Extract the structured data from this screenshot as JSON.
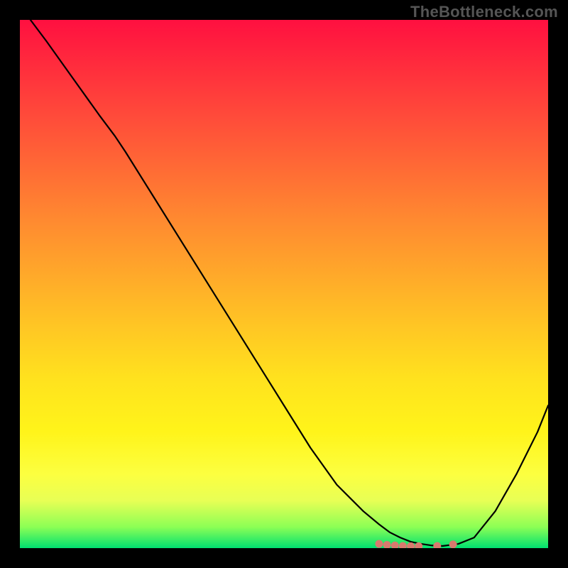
{
  "watermark": "TheBottleneck.com",
  "chart_data": {
    "type": "line",
    "title": "",
    "xlabel": "",
    "ylabel": "",
    "xlim": [
      0,
      100
    ],
    "ylim": [
      0,
      100
    ],
    "grid": false,
    "legend": false,
    "series": [
      {
        "name": "curve",
        "color": "#000000",
        "x": [
          2,
          5,
          10,
          15,
          18,
          20,
          25,
          30,
          35,
          40,
          45,
          50,
          55,
          60,
          63,
          65,
          68,
          70,
          72,
          74,
          76,
          78,
          80,
          83,
          86,
          90,
          94,
          98,
          100
        ],
        "y": [
          100,
          96,
          89,
          82,
          78,
          75,
          67,
          59,
          51,
          43,
          35,
          27,
          19,
          12,
          9,
          7,
          4.5,
          3,
          2,
          1.2,
          0.8,
          0.5,
          0.4,
          0.8,
          2,
          7,
          14,
          22,
          27
        ]
      }
    ],
    "markers": {
      "color": "#D87A6E",
      "points": [
        {
          "x": 68,
          "y": 0.8
        },
        {
          "x": 69.5,
          "y": 0.6
        },
        {
          "x": 71,
          "y": 0.5
        },
        {
          "x": 72.5,
          "y": 0.4
        },
        {
          "x": 74,
          "y": 0.35
        },
        {
          "x": 75.5,
          "y": 0.35
        },
        {
          "x": 79,
          "y": 0.4
        },
        {
          "x": 82,
          "y": 0.7
        }
      ]
    },
    "gradient_stops": [
      {
        "pos": 0.0,
        "color": "#ff1040"
      },
      {
        "pos": 0.5,
        "color": "#ffa82a"
      },
      {
        "pos": 0.78,
        "color": "#fff41a"
      },
      {
        "pos": 1.0,
        "color": "#00e070"
      }
    ]
  }
}
